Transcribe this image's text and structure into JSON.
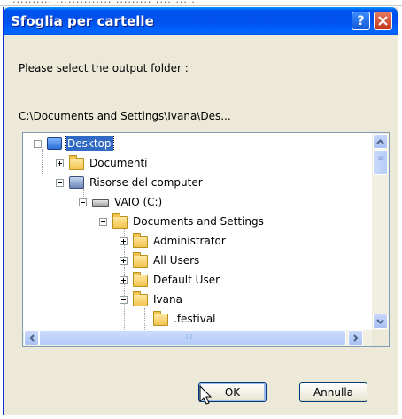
{
  "background_window": {
    "text": "..........  ..............  .........  ....  ......"
  },
  "dialog": {
    "title": "Sfoglia per cartelle",
    "help_label": "?",
    "close_label": "X",
    "prompt": "Please select the output folder :",
    "selected_path": "C:\\Documents and Settings\\Ivana\\Des..."
  },
  "tree": {
    "items": [
      {
        "label": "Desktop",
        "icon": "desktop-icon",
        "expander": "minus",
        "selected": true
      },
      {
        "label": "Documenti",
        "icon": "documents-folder-icon",
        "expander": "plus"
      },
      {
        "label": "Risorse del computer",
        "icon": "computer-icon",
        "expander": "minus"
      },
      {
        "label": "VAIO (C:)",
        "icon": "drive-icon",
        "expander": "minus"
      },
      {
        "label": "Documents and Settings",
        "icon": "folder-icon",
        "expander": "minus"
      },
      {
        "label": "Administrator",
        "icon": "folder-icon",
        "expander": "plus"
      },
      {
        "label": "All Users",
        "icon": "folder-icon",
        "expander": "plus"
      },
      {
        "label": "Default User",
        "icon": "folder-icon",
        "expander": "plus"
      },
      {
        "label": "Ivana",
        "icon": "folder-icon",
        "expander": "minus"
      },
      {
        "label": ".festival",
        "icon": "folder-icon",
        "expander": "none"
      }
    ]
  },
  "buttons": {
    "ok": "OK",
    "cancel": "Annulla"
  }
}
